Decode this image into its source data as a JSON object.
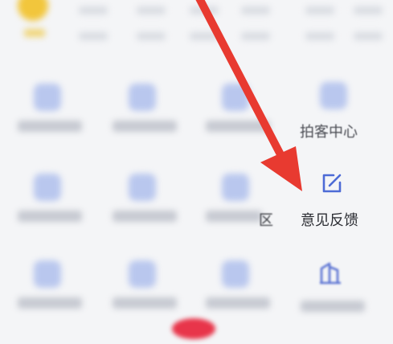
{
  "menu": {
    "photographer_center": "拍客中心",
    "feedback": "意见反馈",
    "partial_char": "区"
  },
  "icons": {
    "feedback": "edit-note-icon",
    "building": "building-icon"
  },
  "colors": {
    "icon_blue": "#4d6bd6",
    "arrow_red": "#e83a30"
  }
}
